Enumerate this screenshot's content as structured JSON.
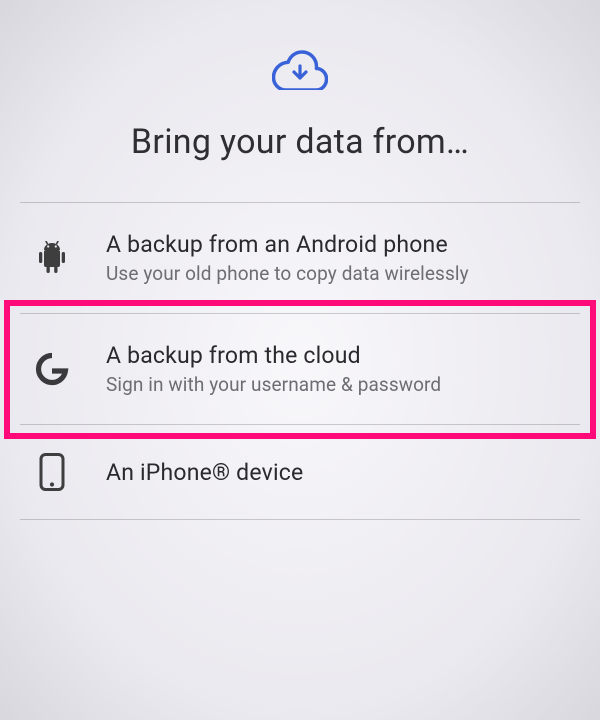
{
  "header": {
    "title": "Bring your data from…"
  },
  "options": [
    {
      "title": "A backup from an Android phone",
      "subtitle": "Use your old phone to copy data wirelessly"
    },
    {
      "title": "A backup from the cloud",
      "subtitle": "Sign in with your username & password"
    },
    {
      "title": "An iPhone® device",
      "subtitle": ""
    }
  ],
  "colors": {
    "accent": "#3a62d8",
    "highlight": "#ff0a78"
  }
}
